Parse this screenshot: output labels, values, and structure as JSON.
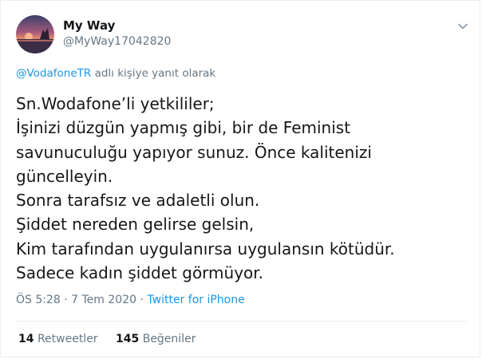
{
  "author": {
    "name": "My Way",
    "handle": "@MyWay17042820"
  },
  "reply_context": {
    "mention": "@VodafoneTR",
    "text": " adlı kişiye yanıt olarak"
  },
  "tweet_lines": [
    "Sn.Wodafone’li yetkililer;",
    "İşinizi düzgün yapmış gibi, bir de Feminist",
    "savunuculuğu yapıyor sunuz. Önce kalitenizi",
    "güncelleyin.",
    "Sonra tarafsız ve adaletli olun.",
    "Şiddet nereden gelirse gelsin,",
    "Kim tarafından uygulanırsa uygulansın kötüdür.",
    "Sadece kadın şiddet görmüyor."
  ],
  "meta": {
    "time": "ÖS 5:28",
    "separator": " · ",
    "date": "7 Tem 2020",
    "source": "Twitter for iPhone"
  },
  "stats": {
    "retweets_count": "14",
    "retweets_label": "Retweetler",
    "likes_count": "145",
    "likes_label": "Beğeniler"
  },
  "icons": {
    "more": "chevron-down-icon"
  }
}
